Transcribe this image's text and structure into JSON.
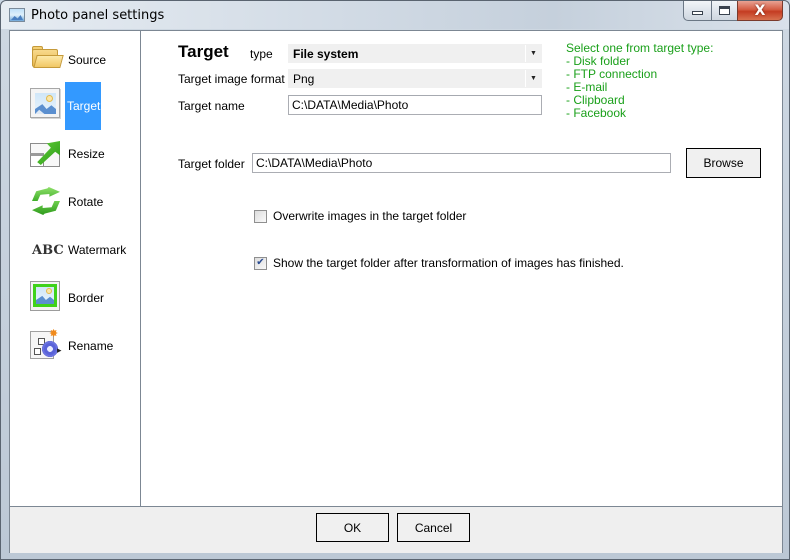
{
  "window": {
    "title": "Photo panel settings",
    "icon": "picture-icon",
    "caption_buttons": [
      {
        "name": "minimize",
        "icon": "minimize-icon"
      },
      {
        "name": "maximize",
        "icon": "maximize-icon"
      },
      {
        "name": "close",
        "icon": "close-icon",
        "glyph": "X"
      }
    ]
  },
  "sidebar": {
    "items": [
      {
        "label": "Source",
        "icon": "folder-icon",
        "active": false
      },
      {
        "label": "Target",
        "icon": "picture-icon",
        "active": true
      },
      {
        "label": "Resize",
        "icon": "resize-icon",
        "active": false
      },
      {
        "label": "Rotate",
        "icon": "rotate-icon",
        "active": false
      },
      {
        "label": "Watermark",
        "icon": "abc-text-icon",
        "icon_text": "ABC",
        "active": false
      },
      {
        "label": "Border",
        "icon": "border-icon",
        "active": false
      },
      {
        "label": "Rename",
        "icon": "rename-icon",
        "active": false
      }
    ],
    "active_color": "#3399ff"
  },
  "main": {
    "heading": "Target",
    "type_label": "type",
    "type_value": "File system",
    "format_label": "Target image format",
    "format_value": "Png",
    "name_label": "Target name",
    "name_value": "C:\\DATA\\Media\\Photo",
    "hint": {
      "title": "Select one from target type:",
      "items": [
        "- Disk folder",
        "- FTP connection",
        "- E-mail",
        "- Clipboard",
        "- Facebook"
      ],
      "color": "#1aa01a"
    },
    "folder_label": "Target folder",
    "folder_value": "C:\\DATA\\Media\\Photo",
    "browse_label": "Browse",
    "overwrite_label": "Overwrite images in the target folder",
    "overwrite_checked": false,
    "show_folder_label": "Show the target folder after transformation of images has finished.",
    "show_folder_checked": true,
    "check_glyph": "✔"
  },
  "footer": {
    "ok_label": "OK",
    "cancel_label": "Cancel"
  }
}
